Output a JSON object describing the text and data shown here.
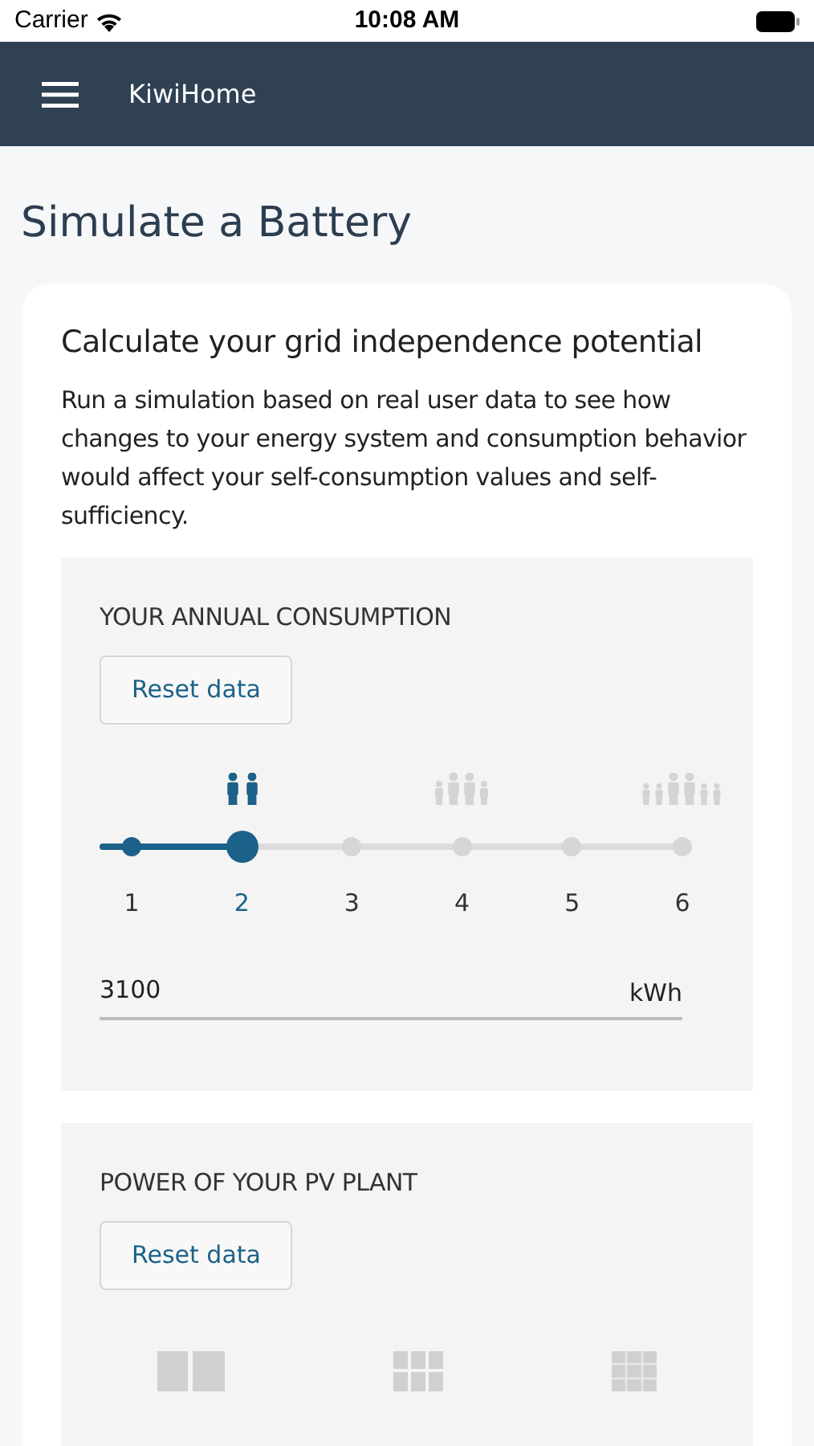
{
  "status_bar": {
    "carrier": "Carrier",
    "time": "10:08 AM"
  },
  "app_bar": {
    "title": "KiwiHome"
  },
  "page_title": "Simulate a Battery",
  "card": {
    "heading": "Calculate your grid independence potential",
    "description": "Run a simulation based on real user data to see how changes to your energy system and consumption behavior would affect your self-consumption values and self-sufficiency.",
    "sections": [
      {
        "kind": "consumption",
        "title": "YOUR ANNUAL CONSUMPTION",
        "reset_button": "Reset data",
        "steps": [
          {
            "label": "1",
            "selected": false
          },
          {
            "label": "2",
            "selected": true
          },
          {
            "label": "3",
            "selected": false
          },
          {
            "label": "4",
            "selected": false
          },
          {
            "label": "5",
            "selected": false
          },
          {
            "label": "6",
            "selected": false
          }
        ],
        "field": {
          "value": "3100",
          "unit": "kWh"
        }
      },
      {
        "kind": "pv",
        "title": "POWER OF YOUR PV PLANT",
        "reset_button": "Reset data"
      }
    ]
  }
}
